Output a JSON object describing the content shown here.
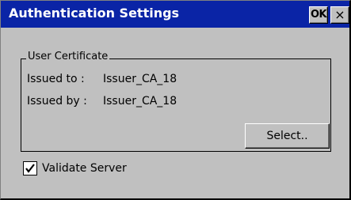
{
  "dialog": {
    "title": "Authentication Settings",
    "ok_label": "OK",
    "close_label": "×"
  },
  "certificate": {
    "group_label": "User Certificate",
    "issued_to_label": "Issued to :",
    "issued_to_value": "Issuer_CA_18",
    "issued_by_label": "Issued by :",
    "issued_by_value": "Issuer_CA_18",
    "select_label": "Select.."
  },
  "validate_server": {
    "label": "Validate Server",
    "checked": true
  },
  "colors": {
    "titlebar": "#0a24a6",
    "background": "#c0c0c0"
  }
}
